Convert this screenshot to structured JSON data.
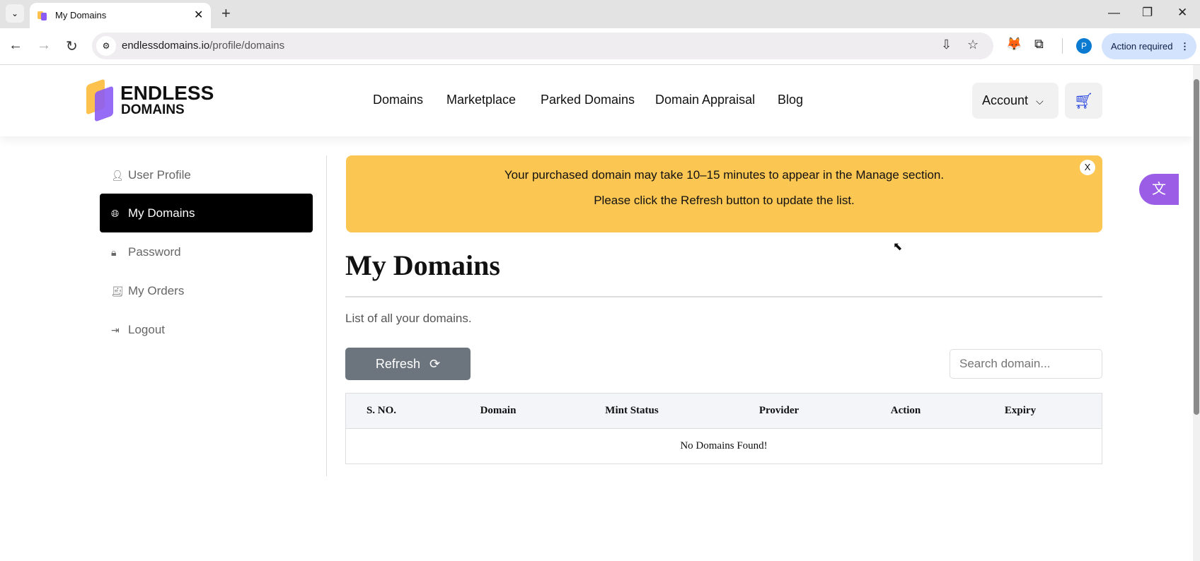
{
  "browser": {
    "tab_title": "My Domains",
    "url_host": "endlessdomains.io",
    "url_path": "/profile/domains",
    "profile_initial": "P",
    "action_required": "Action required"
  },
  "site": {
    "logo_line1": "ENDLESS",
    "logo_line2": "DOMAINS",
    "nav": [
      "Domains",
      "Marketplace",
      "Parked Domains",
      "Domain Appraisal",
      "Blog"
    ],
    "account_label": "Account"
  },
  "sidebar": {
    "items": [
      {
        "label": "User Profile",
        "icon": "user-icon"
      },
      {
        "label": "My Domains",
        "icon": "globe-icon"
      },
      {
        "label": "Password",
        "icon": "lock-icon"
      },
      {
        "label": "My Orders",
        "icon": "orders-icon"
      },
      {
        "label": "Logout",
        "icon": "logout-icon"
      }
    ]
  },
  "banner": {
    "line1": "Your purchased domain may take 10–15 minutes to appear in the Manage section.",
    "line2": "Please click the Refresh button to update the list.",
    "close": "X"
  },
  "main": {
    "title": "My Domains",
    "subtitle": "List of all your domains.",
    "refresh_label": "Refresh",
    "search_placeholder": "Search domain...",
    "table": {
      "columns": [
        "S. NO.",
        "Domain",
        "Mint Status",
        "Provider",
        "Action",
        "Expiry"
      ],
      "empty_message": "No Domains Found!"
    }
  },
  "colors": {
    "banner": "#fcc653",
    "accent": "#9b5de5",
    "active": "#000000"
  }
}
